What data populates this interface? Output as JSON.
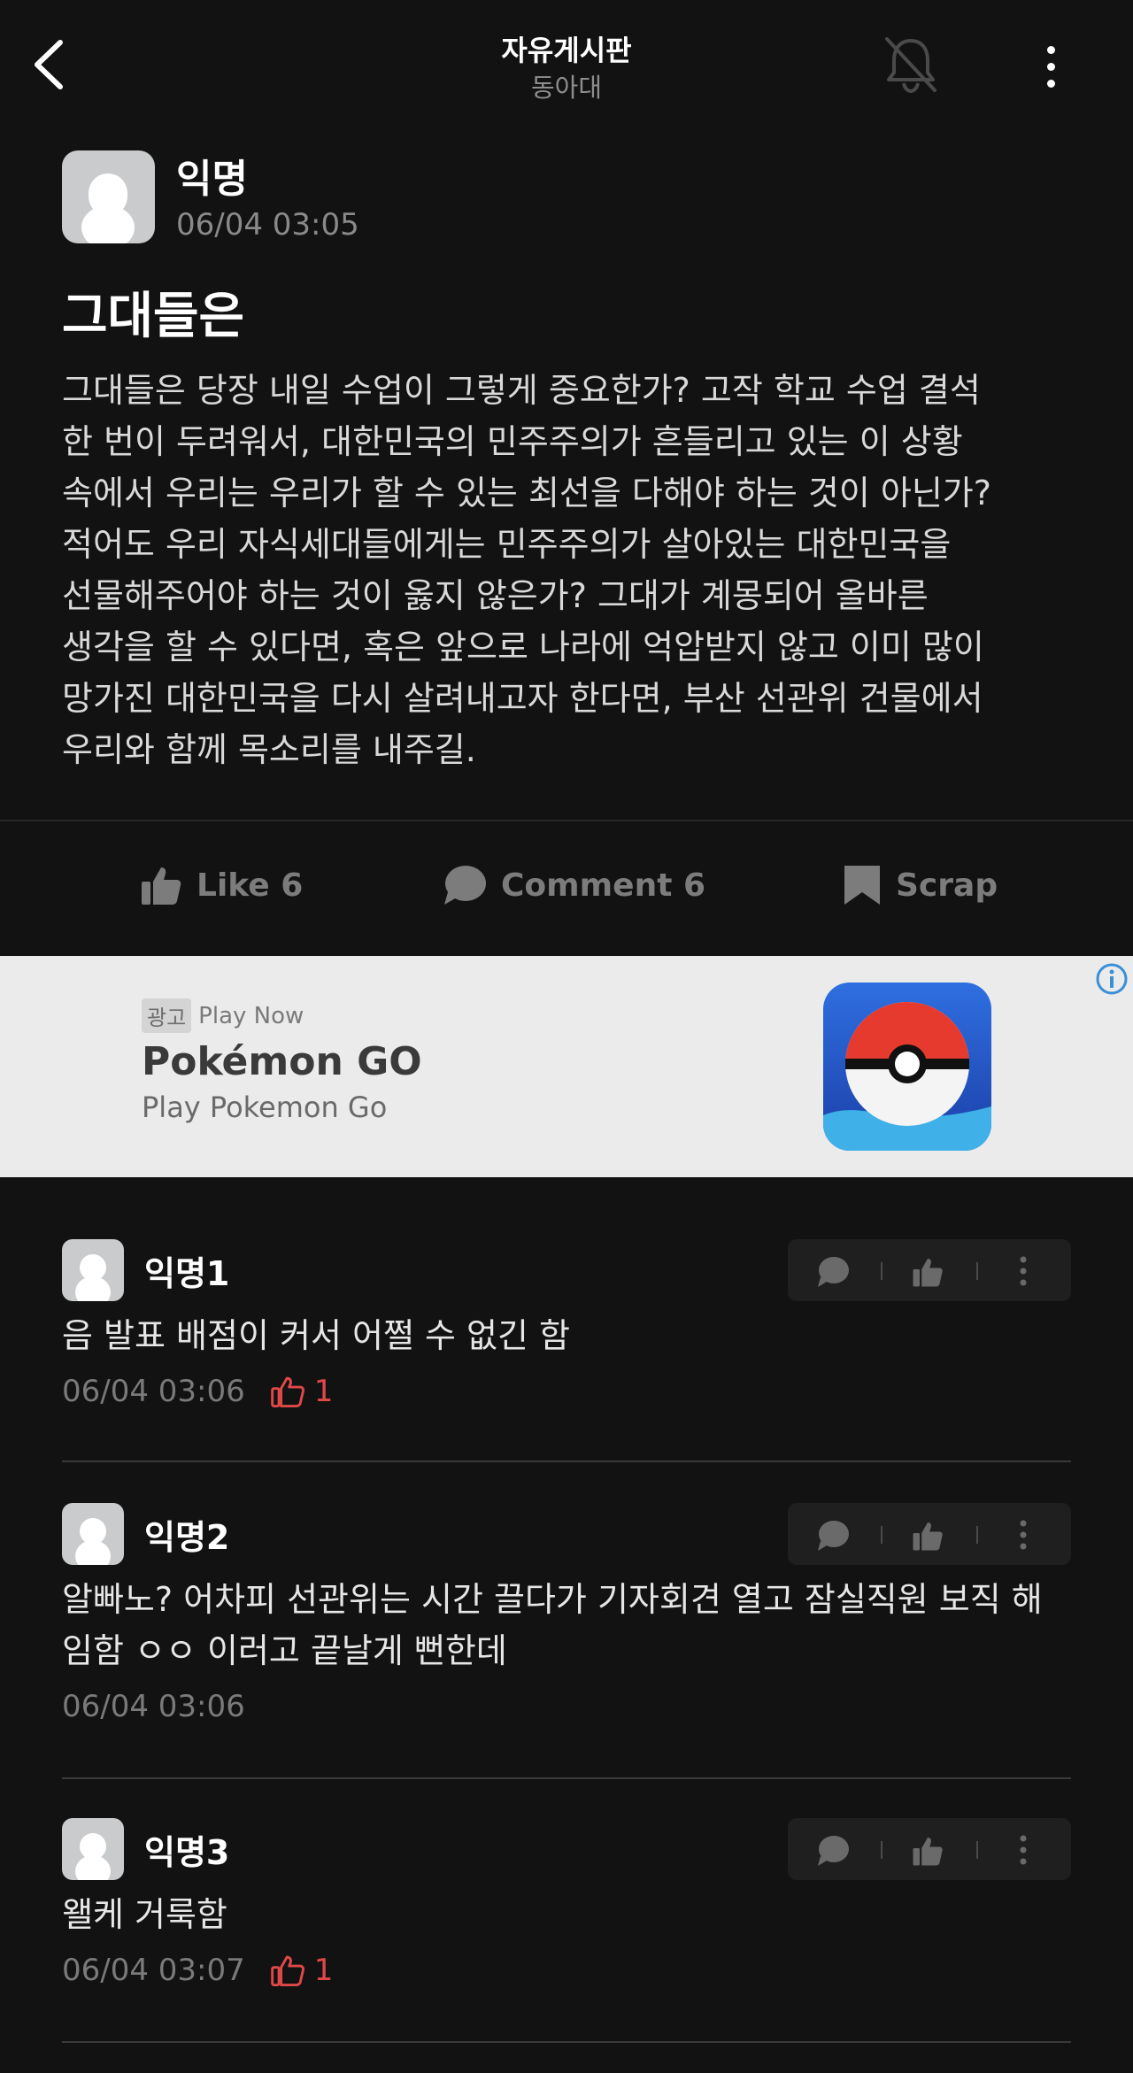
{
  "header": {
    "title": "자유게시판",
    "subtitle": "동아대",
    "back_icon": "chevron-left-icon",
    "notify_icon": "bell-off-icon",
    "more_icon": "more-vertical-icon"
  },
  "post": {
    "author": "익명",
    "time": "06/04 03:05",
    "title": "그대들은",
    "body": "그대들은 당장 내일 수업이 그렇게 중요한가? 고작 학교 수업 결석\n한 번이 두려워서, 대한민국의 민주주의가 흔들리고 있는 이 상황\n속에서 우리는 우리가 할 수 있는 최선을 다해야 하는 것이 아닌가?\n적어도 우리 자식세대들에게는 민주주의가 살아있는 대한민국을\n선물해주어야 하는 것이 옳지 않은가? 그대가 계몽되어 올바른\n생각을 할 수 있다면, 혹은 앞으로 나라에 억압받지 않고 이미 많이\n망가진 대한민국을 다시 살려내고자 한다면, 부산 선관위 건물에서\n우리와 함께 목소리를 내주길."
  },
  "actions": {
    "like": "Like 6",
    "comment": "Comment 6",
    "scrap": "Scrap"
  },
  "ad": {
    "tag": "광고",
    "cta": "Play Now",
    "title": "Pokémon GO",
    "subtitle": "Play Pokemon Go",
    "info_icon": "info-icon"
  },
  "comments": [
    {
      "name": "익명1",
      "text": "음 발표 배점이 커서 어쩔 수 없긴 함",
      "time": "06/04 03:06",
      "likes": "1"
    },
    {
      "name": "익명2",
      "text": "알빠노? 어차피 선관위는 시간 끌다가 기자회견 열고 잠실직원 보직 해임함 ㅇㅇ 이러고 끝날게 뻔한데",
      "time": "06/04 03:06",
      "likes": ""
    },
    {
      "name": "익명3",
      "text": "왤케 거룩함",
      "time": "06/04 03:07",
      "likes": "1"
    }
  ],
  "colors": {
    "background": "#121212",
    "like_red": "#e04848",
    "muted": "#7c7c7c"
  }
}
